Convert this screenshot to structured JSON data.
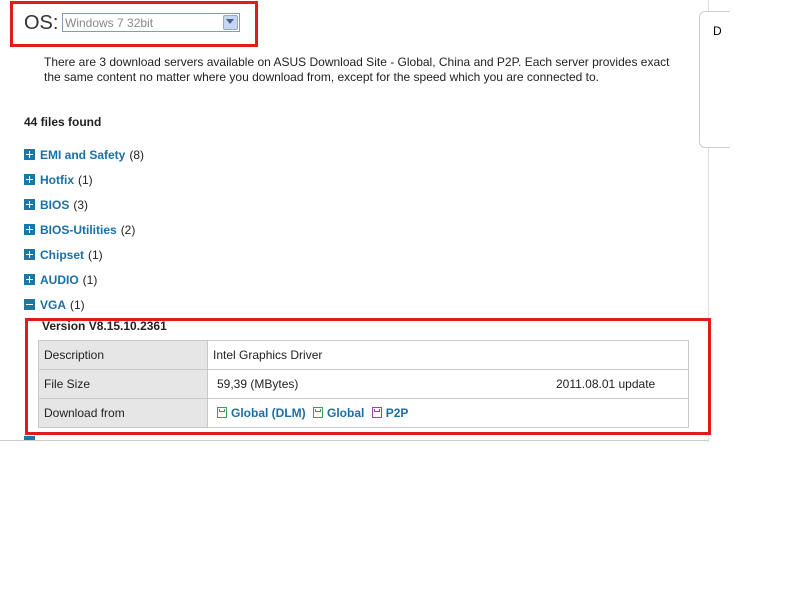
{
  "os": {
    "label": "OS:",
    "selected": "Windows 7 32bit"
  },
  "notice": "There are 3 download servers available on ASUS Download Site - Global, China and P2P. Each server provides exact the same content no matter where you download from, except for the speed which you are connected to.",
  "files_found": "44 files found",
  "categories": [
    {
      "name": "EMI and Safety",
      "count": "(8)",
      "expanded": false
    },
    {
      "name": "Hotfix",
      "count": "(1)",
      "expanded": false
    },
    {
      "name": "BIOS",
      "count": "(3)",
      "expanded": false
    },
    {
      "name": "BIOS-Utilities",
      "count": "(2)",
      "expanded": false
    },
    {
      "name": "Chipset",
      "count": "(1)",
      "expanded": false
    },
    {
      "name": "AUDIO",
      "count": "(1)",
      "expanded": false
    },
    {
      "name": "VGA",
      "count": "(1)",
      "expanded": true
    }
  ],
  "vga_detail": {
    "version": "Version  V8.15.10.2361",
    "description_label": "Description",
    "description_value": "Intel Graphics Driver",
    "file_size_label": "File Size",
    "file_size_value": "59,39 (MBytes)",
    "date_value": "2011.08.01  update",
    "download_label": "Download from",
    "links": {
      "global_dlm": "Global (DLM)",
      "global": "Global",
      "p2p": "P2P"
    }
  },
  "colors": {
    "highlight_box": "#e31a1a",
    "link": "#1a6fa5",
    "expander": "#1a78a8"
  },
  "icons": {
    "expand": "plus-square-icon",
    "collapse": "minus-square-icon",
    "download": "floppy-disk-icon"
  }
}
